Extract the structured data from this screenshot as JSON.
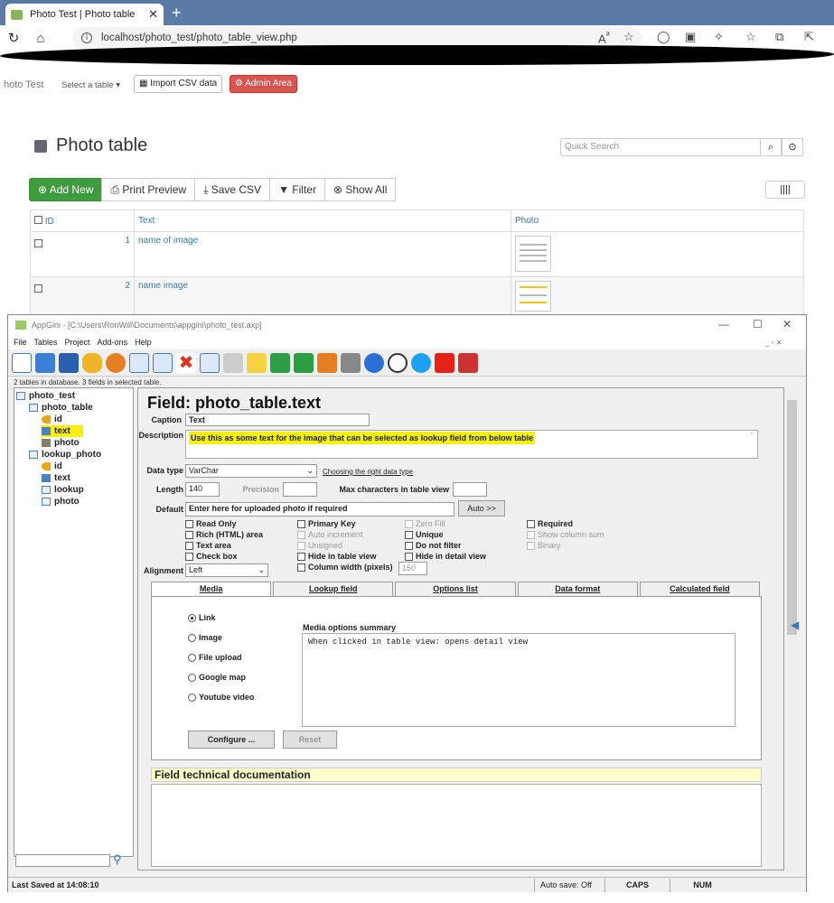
{
  "browser": {
    "tab_title": "Photo Test | Photo table",
    "url": "localhost/photo_test/photo_table_view.php"
  },
  "webapp": {
    "brand": "hoto Test",
    "select_table": "Select a table ▾",
    "import_csv": "Import CSV data",
    "admin_area": "Admin Area",
    "page_title": "Photo table",
    "search_placeholder": "Quick Search",
    "toolbar": {
      "add_new": "Add New",
      "print_preview": "Print Preview",
      "save_csv": "Save CSV",
      "filter": "Filter",
      "show_all": "Show All"
    },
    "table": {
      "headers": [
        "ID",
        "Text",
        "Photo"
      ],
      "rows": [
        {
          "id": "1",
          "text": "name of image"
        },
        {
          "id": "2",
          "text": "name image"
        }
      ]
    }
  },
  "appgini": {
    "window_title": "AppGini - [C:\\Users\\RonWill\\Documents\\appgini\\photo_test.axp]",
    "menu": [
      "File",
      "Tables",
      "Project",
      "Add-ons",
      "Help"
    ],
    "db_status": "2 tables in database. 3 fields in selected table.",
    "tree": {
      "project": "photo_test",
      "table1": "photo_table",
      "t1_fields": [
        "id",
        "text",
        "photo"
      ],
      "table2": "lookup_photo",
      "t2_fields": [
        "id",
        "text",
        "lookup",
        "photo"
      ]
    },
    "field_title": "Field: photo_table.text",
    "caption_label": "Caption",
    "caption_value": "Text",
    "description_label": "Description",
    "description_value": "Use this as some text for the image that can be selected as lookup field from below table",
    "datatype_label": "Data type",
    "datatype_value": "VarChar",
    "choosing_link": "Choosing the right data type",
    "length_label": "Length",
    "length_value": "140",
    "precision_label": "Precision",
    "maxchars_label": "Max characters in table view",
    "default_label": "Default",
    "default_value": "Enter here for uploaded photo if required",
    "auto_btn": "Auto >>",
    "checkboxes": {
      "read_only": "Read Only",
      "rich_html": "Rich (HTML) area",
      "text_area": "Text area",
      "check_box": "Check box",
      "primary_key": "Primary Key",
      "auto_increment": "Auto increment",
      "unsigned": "Unsigned",
      "hide_table": "Hide in table view",
      "zero_fill": "Zero Fill",
      "unique": "Unique",
      "do_not_filter": "Do not filter",
      "hide_detail": "Hide in detail view",
      "required": "Required",
      "show_column_sum": "Show column sum",
      "binary": "Binary",
      "column_width": "Column width (pixels)"
    },
    "column_width_value": "150",
    "alignment_label": "Alignment",
    "alignment_value": "Left",
    "tabs": [
      "Media",
      "Lookup field",
      "Options list",
      "Data format",
      "Calculated field"
    ],
    "media_options": [
      "Link",
      "Image",
      "File upload",
      "Google map",
      "Youtube video"
    ],
    "media_summary_label": "Media options summary",
    "media_summary": "When clicked in table view: opens detail view",
    "configure_btn": "Configure ...",
    "reset_btn": "Reset",
    "tech_doc_title": "Field technical documentation",
    "status": {
      "last_saved": "Last Saved at 14:08:10",
      "autosave": "Auto save: Off",
      "caps": "CAPS",
      "num": "NUM"
    }
  }
}
